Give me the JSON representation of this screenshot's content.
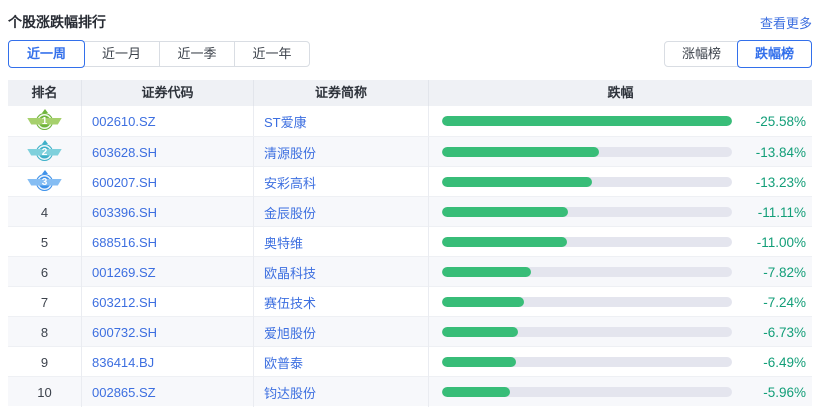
{
  "page": {
    "title": "个股涨跌幅排行",
    "more_link": "查看更多"
  },
  "filters": {
    "periods": [
      {
        "label": "近一周",
        "selected": true
      },
      {
        "label": "近一月",
        "selected": false
      },
      {
        "label": "近一季",
        "selected": false
      },
      {
        "label": "近一年",
        "selected": false
      }
    ],
    "rank_tabs": [
      {
        "label": "涨幅榜",
        "selected": false
      },
      {
        "label": "跌幅榜",
        "selected": true
      }
    ]
  },
  "table": {
    "columns": [
      "排名",
      "证券代码",
      "证券简称",
      "跌幅"
    ],
    "rows": [
      {
        "rank": "1",
        "code": "002610.SZ",
        "name": "ST爱康",
        "pct": "-25.58%",
        "value": -25.58
      },
      {
        "rank": "2",
        "code": "603628.SH",
        "name": "清源股份",
        "pct": "-13.84%",
        "value": -13.84
      },
      {
        "rank": "3",
        "code": "600207.SH",
        "name": "安彩高科",
        "pct": "-13.23%",
        "value": -13.23
      },
      {
        "rank": "4",
        "code": "603396.SH",
        "name": "金辰股份",
        "pct": "-11.11%",
        "value": -11.11
      },
      {
        "rank": "5",
        "code": "688516.SH",
        "name": "奥特维",
        "pct": "-11.00%",
        "value": -11.0
      },
      {
        "rank": "6",
        "code": "001269.SZ",
        "name": "欧晶科技",
        "pct": "-7.82%",
        "value": -7.82
      },
      {
        "rank": "7",
        "code": "603212.SH",
        "name": "赛伍技术",
        "pct": "-7.24%",
        "value": -7.24
      },
      {
        "rank": "8",
        "code": "600732.SH",
        "name": "爱旭股份",
        "pct": "-6.73%",
        "value": -6.73
      },
      {
        "rank": "9",
        "code": "836414.BJ",
        "name": "欧普泰",
        "pct": "-6.49%",
        "value": -6.49
      },
      {
        "rank": "10",
        "code": "002865.SZ",
        "name": "钧达股份",
        "pct": "-5.96%",
        "value": -5.96
      }
    ]
  },
  "colors": {
    "accent_blue": "#3370eb",
    "link_blue": "#3d6fe0",
    "bar_fill": "#38bd78",
    "bar_track": "#e4e5ee",
    "pct_text": "#129e78",
    "medals": [
      {
        "main": "#6fb53c",
        "wing": "#a6d06c"
      },
      {
        "main": "#3fb0c9",
        "wing": "#7fd0dc"
      },
      {
        "main": "#3f92ea",
        "wing": "#85bdf3"
      }
    ]
  }
}
